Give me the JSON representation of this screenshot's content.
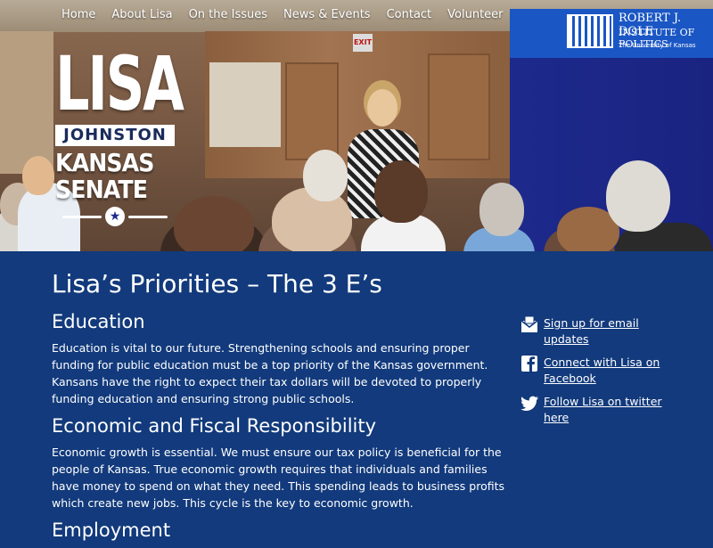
{
  "nav": {
    "items": [
      {
        "label": "Home"
      },
      {
        "label": "About Lisa"
      },
      {
        "label": "On the Issues"
      },
      {
        "label": "News & Events"
      },
      {
        "label": "Contact"
      },
      {
        "label": "Volunteer"
      }
    ]
  },
  "logo": {
    "first": "LISA",
    "last": "JOHNSTON",
    "line1": "KANSAS",
    "line2": "SENATE",
    "star": "★"
  },
  "hero": {
    "banner_line1": "ROBERT J. DOLE",
    "banner_line2": "INSTITUTE OF POLITICS",
    "banner_line3": "The University of Kansas",
    "exit_sign": "EXIT"
  },
  "main": {
    "title": "Lisa’s Priorities – The 3 E’s",
    "sections": [
      {
        "heading": "Education",
        "text": "Education is vital to our future. Strengthening schools and ensuring proper funding for public education must be a top priority of the Kansas government. Kansans have the right to expect their tax dollars will be devoted to properly funding education and ensuring strong public schools."
      },
      {
        "heading": "Economic and Fiscal Responsibility",
        "text": "Economic growth is essential. We must ensure our tax policy is beneficial for the people of Kansas. True economic growth requires that individuals and families have money to spend on what they need. This spending leads to business profits which create new jobs. This cycle is the key to economic growth."
      },
      {
        "heading": "Employment",
        "text": ""
      }
    ]
  },
  "sidebar": {
    "links": [
      {
        "label": "Sign up for email updates",
        "icon": "envelope-icon"
      },
      {
        "label": "Connect with Lisa on Facebook",
        "icon": "facebook-icon"
      },
      {
        "label": "Follow Lisa on twitter here",
        "icon": "twitter-icon"
      }
    ]
  },
  "colors": {
    "main_bg": "#123a7c",
    "text": "#ffffff",
    "curtain": "#1d2a8c",
    "banner": "#1a56c4"
  }
}
